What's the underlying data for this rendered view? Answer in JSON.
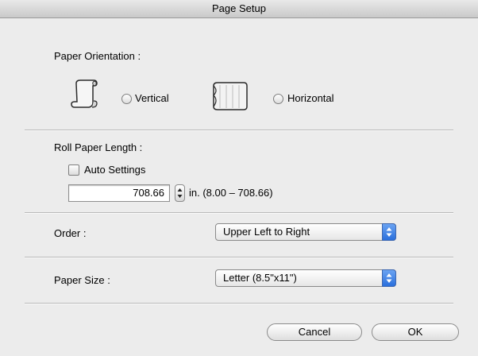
{
  "window": {
    "title": "Page Setup"
  },
  "orientation": {
    "label": "Paper Orientation :",
    "options": [
      {
        "label": "Vertical",
        "icon": "portrait-roll-icon",
        "selected": false
      },
      {
        "label": "Horizontal",
        "icon": "landscape-roll-icon",
        "selected": false
      }
    ]
  },
  "roll": {
    "label": "Roll Paper Length :",
    "auto_label": "Auto Settings",
    "auto_checked": false,
    "value": "708.66",
    "range": "in. (8.00 – 708.66)"
  },
  "order": {
    "label": "Order :",
    "selected": "Upper Left to Right"
  },
  "paper_size": {
    "label": "Paper Size :",
    "selected": "Letter (8.5\"x11\")"
  },
  "buttons": {
    "cancel": "Cancel",
    "ok": "OK"
  },
  "colors": {
    "popup_accent": "#3a7be0",
    "window_bg": "#ececec"
  }
}
